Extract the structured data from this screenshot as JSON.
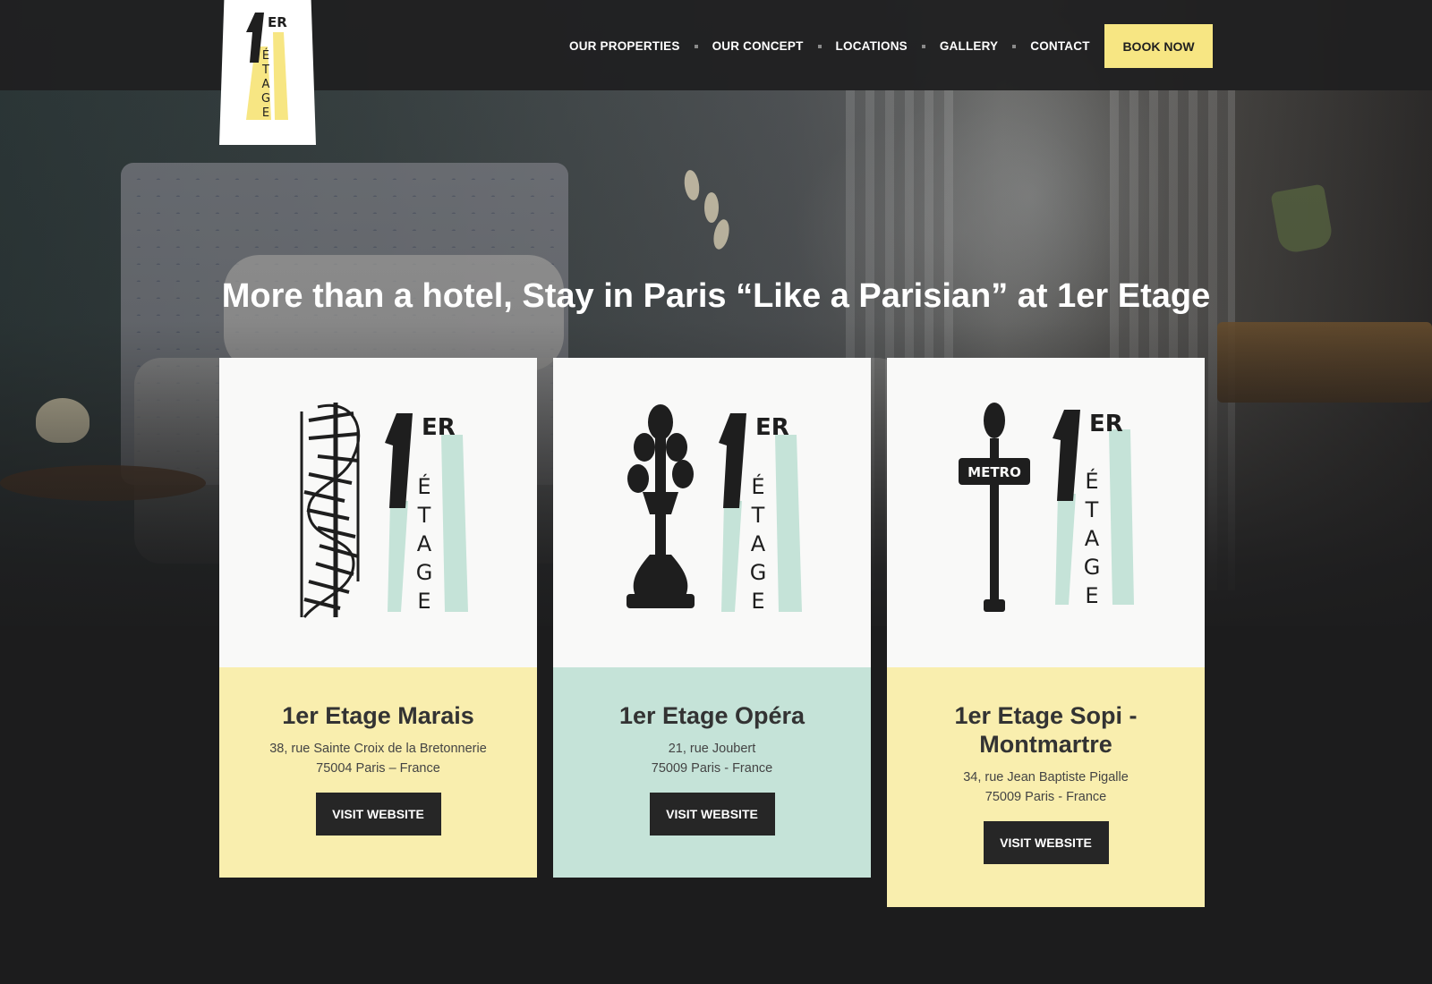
{
  "brand": {
    "name": "1er Étage",
    "logo_numeral": "1",
    "logo_suffix": "ER",
    "logo_word": [
      "É",
      "T",
      "A",
      "G",
      "E"
    ],
    "colors": {
      "yellow": "#f7e683",
      "mint": "#c5e3d8",
      "dark": "#1c1c1d"
    }
  },
  "nav": {
    "items": [
      {
        "label": "OUR PROPERTIES"
      },
      {
        "label": "OUR CONCEPT"
      },
      {
        "label": "LOCATIONS"
      },
      {
        "label": "GALLERY"
      },
      {
        "label": "CONTACT"
      }
    ],
    "book_label": "BOOK NOW"
  },
  "hero": {
    "headline": "More than a hotel, Stay in Paris “Like a Parisian” at 1er Etage"
  },
  "properties": [
    {
      "title": "1er Etage Marais",
      "address_line1": "38, rue Sainte Croix de la Bretonnerie",
      "address_line2": "75004 Paris – France",
      "button": "VISIT WEBSITE",
      "illustration": "spiral-staircase-icon",
      "bg": "#f9eeae"
    },
    {
      "title": "1er Etage Opéra",
      "address_line1": "21, rue Joubert",
      "address_line2": "75009 Paris - France",
      "button": "VISIT WEBSITE",
      "illustration": "street-lamp-icon",
      "bg": "#c5e3d8"
    },
    {
      "title": "1er Etage Sopi - Montmartre",
      "address_line1": "34, rue Jean Baptiste Pigalle",
      "address_line2": "75009 Paris - France",
      "button": "VISIT WEBSITE",
      "illustration": "metro-sign-icon",
      "metro_text": "METRO",
      "bg": "#f9eeae"
    }
  ]
}
